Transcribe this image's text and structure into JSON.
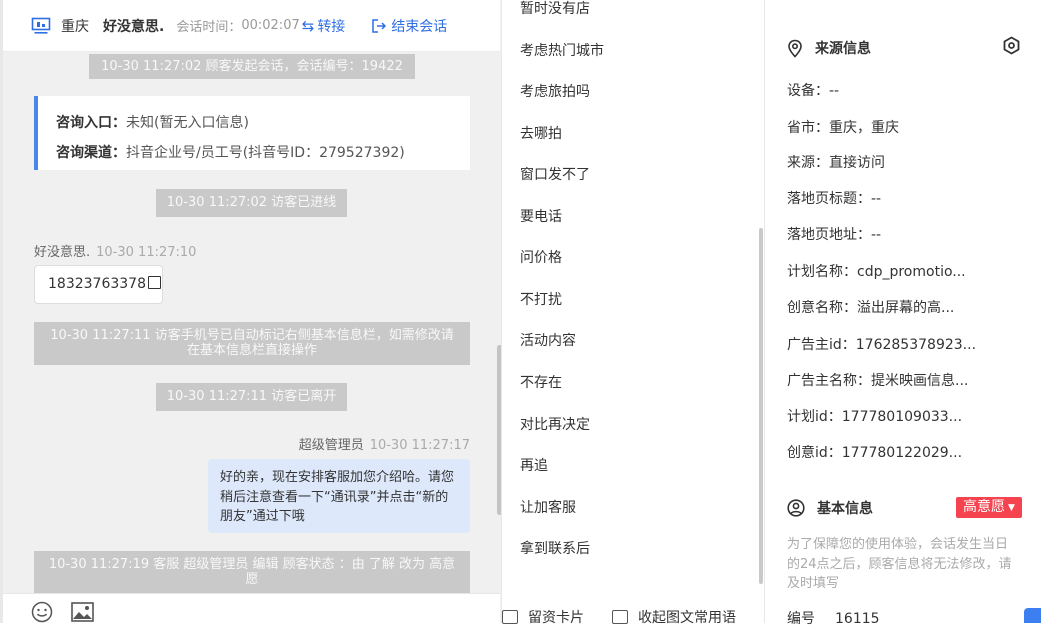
{
  "chat": {
    "header": {
      "city": "重庆",
      "visitor_name": "好没意思.",
      "duration_label": "会话时间：",
      "duration": "00:02:07",
      "transfer": "转接",
      "end": "结束会话"
    },
    "messages": {
      "sys1": "10-30 11:27:02 顾客发起会话，会话编号：19422",
      "entry_label": "咨询入口：",
      "entry_value": "未知(暂无入口信息)",
      "channel_label": "咨询渠道：",
      "channel_value": "抖音企业号/员工号(抖音号ID：279527392)",
      "sys2": "10-30 11:27:02 访客已进线",
      "visitor_sender": "好没意思.",
      "visitor_time": "10-30 11:27:10",
      "phone": "18323763378",
      "sys3": "10-30 11:27:11 访客手机号已自动标记右侧基本信息栏，如需修改请在基本信息栏直接操作",
      "sys4": "10-30 11:27:11 访客已离开",
      "admin_sender": "超级管理员",
      "admin_time": "10-30 11:27:17",
      "admin_text": "好的亲，现在安排客服加您介绍哈。请您稍后注意查看一下“通讯录”并点击“新的朋友”通过下哦",
      "sys5": "10-30 11:27:19 客服 超级管理员 编辑 顾客状态 ：由 了解 改为 高意愿"
    }
  },
  "quick_replies": {
    "items": [
      "暂时没有店",
      "考虑热门城市",
      "考虑旅拍吗",
      "去哪拍",
      "窗口发不了",
      "要电话",
      "问价格",
      "不打扰",
      "活动内容",
      "不存在",
      "对比再决定",
      "再追",
      "让加客服",
      "拿到联系后"
    ],
    "footer_left": "留资卡片",
    "footer_right": "收起图文常用语"
  },
  "source_info": {
    "title": "来源信息",
    "fields": [
      "设备：--",
      "省市：重庆，重庆",
      "来源：直接访问",
      "落地页标题：--",
      "落地页地址：--",
      "计划名称：cdp_promotio...",
      "创意名称：溢出屏幕的高...",
      "广告主id：176285378923...",
      "广告主名称：提米映画信息...",
      "计划id：177780109033...",
      "创意id：177780122029..."
    ]
  },
  "basic_info": {
    "title": "基本信息",
    "intent_badge": "高意愿",
    "notice": "为了保障您的使用体验，会话发生当日的24点之后，顾客信息将无法修改，请及时填写",
    "id_label": "编号",
    "id_value": "16115"
  },
  "colors": {
    "accent": "#2f6fe4",
    "badge_red": "#f5434f",
    "admin_bubble": "#dde8fb",
    "system_msg": "#c9c9c9"
  },
  "icons": [
    "monitor-icon",
    "transfer-icon",
    "logout-icon",
    "emoji-icon",
    "image-icon",
    "location-icon",
    "settings-icon",
    "user-circle-icon",
    "card-icon",
    "caret-down-icon"
  ]
}
